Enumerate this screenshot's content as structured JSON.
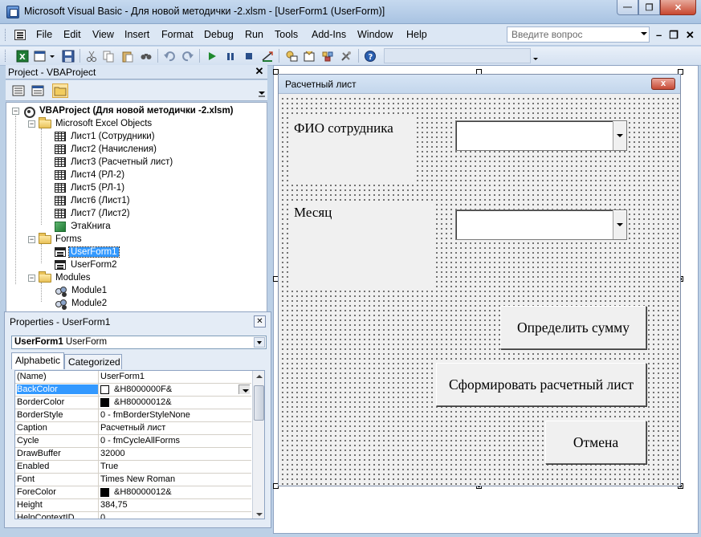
{
  "window": {
    "title": "Microsoft Visual Basic - Для новой методички -2.xlsm - [UserForm1 (UserForm)]"
  },
  "menu": {
    "items": [
      "File",
      "Edit",
      "View",
      "Insert",
      "Format",
      "Debug",
      "Run",
      "Tools",
      "Add-Ins",
      "Window",
      "Help"
    ],
    "ask_placeholder": "Введите вопрос"
  },
  "project": {
    "title": "Project - VBAProject",
    "root": "VBAProject (Для новой методички -2.xlsm)",
    "folders": {
      "excel_objects": "Microsoft Excel Objects",
      "forms": "Forms",
      "modules": "Modules"
    },
    "sheets": [
      "Лист1 (Сотрудники)",
      "Лист2 (Начисления)",
      "Лист3 (Расчетный лист)",
      "Лист4 (РЛ-2)",
      "Лист5 (РЛ-1)",
      "Лист6 (Лист1)",
      "Лист7 (Лист2)",
      "ЭтаКнига"
    ],
    "forms": [
      "UserForm1",
      "UserForm2"
    ],
    "modules": [
      "Module1",
      "Module2"
    ]
  },
  "properties": {
    "title": "Properties - UserForm1",
    "object_name": "UserForm1",
    "object_type": "UserForm",
    "tabs": [
      "Alphabetic",
      "Categorized"
    ],
    "rows": [
      {
        "name": "(Name)",
        "value": "UserForm1"
      },
      {
        "name": "BackColor",
        "value": "&H8000000F&",
        "swatch": "#ffffff"
      },
      {
        "name": "BorderColor",
        "value": "&H80000012&",
        "swatch": "#000000"
      },
      {
        "name": "BorderStyle",
        "value": "0 - fmBorderStyleNone"
      },
      {
        "name": "Caption",
        "value": "Расчетный лист"
      },
      {
        "name": "Cycle",
        "value": "0 - fmCycleAllForms"
      },
      {
        "name": "DrawBuffer",
        "value": "32000"
      },
      {
        "name": "Enabled",
        "value": "True"
      },
      {
        "name": "Font",
        "value": "Times New Roman"
      },
      {
        "name": "ForeColor",
        "value": "&H80000012&",
        "swatch": "#000000"
      },
      {
        "name": "Height",
        "value": "384,75"
      },
      {
        "name": "HelpContextID",
        "value": "0"
      }
    ]
  },
  "form": {
    "caption": "Расчетный лист",
    "close_glyph": "x",
    "label_employee": "ФИО сотрудника",
    "label_month": "Месяц",
    "btn_sum": "Определить сумму",
    "btn_payslip": "Сформировать расчетный лист",
    "btn_cancel": "Отмена"
  }
}
